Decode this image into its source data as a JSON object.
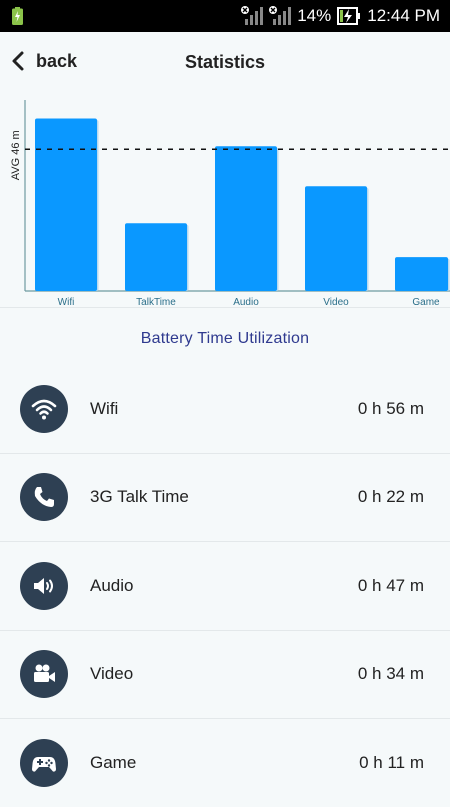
{
  "status_bar": {
    "battery_percent": "14%",
    "time": "12:44 PM"
  },
  "header": {
    "back_label": "back",
    "title": "Statistics"
  },
  "chart_data": {
    "type": "bar",
    "categories": [
      "Wifi",
      "TalkTime",
      "Audio",
      "Video",
      "Game"
    ],
    "values": [
      56,
      22,
      47,
      34,
      11
    ],
    "average": 46,
    "avg_label": "AVG 46 m",
    "ylim": [
      0,
      62
    ],
    "grid": false,
    "bar_color": "#0a98ff",
    "avg_line_color": "#111111"
  },
  "subtitle": "Battery Time Utilization",
  "items": [
    {
      "label": "Wifi",
      "time": "0 h 56 m",
      "icon": "wifi-icon"
    },
    {
      "label": "3G Talk Time",
      "time": "0 h 22 m",
      "icon": "phone-icon"
    },
    {
      "label": "Audio",
      "time": "0 h 47 m",
      "icon": "speaker-icon"
    },
    {
      "label": "Video",
      "time": "0 h 34 m",
      "icon": "video-camera-icon"
    },
    {
      "label": "Game",
      "time": "0 h 11 m",
      "icon": "gamepad-icon"
    }
  ],
  "colors": {
    "icon_circle": "#2e4053",
    "subtitle": "#2f3a8f",
    "background": "#f5f9fa"
  }
}
